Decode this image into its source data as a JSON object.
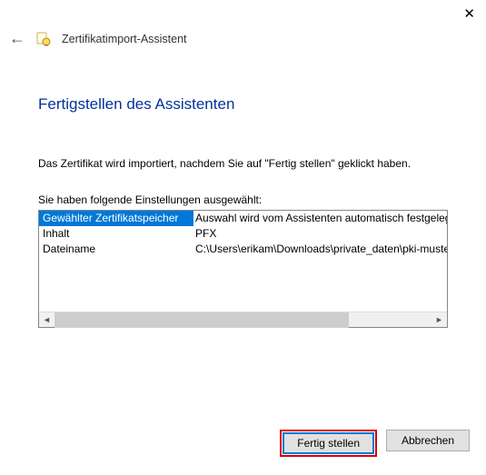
{
  "window": {
    "title": "Zertifikatimport-Assistent"
  },
  "page": {
    "heading": "Fertigstellen des Assistenten",
    "intro": "Das Zertifikat wird importiert, nachdem Sie auf \"Fertig stellen\" geklickt haben.",
    "settings_label": "Sie haben folgende Einstellungen ausgewählt:"
  },
  "settings": {
    "rows": [
      {
        "key": "Gewählter Zertifikatspeicher",
        "value": "Auswahl wird vom Assistenten automatisch festgelegt"
      },
      {
        "key": "Inhalt",
        "value": "PFX"
      },
      {
        "key": "Dateiname",
        "value": "C:\\Users\\erikam\\Downloads\\private_daten\\pki-musterm"
      }
    ]
  },
  "buttons": {
    "finish": "Fertig stellen",
    "cancel": "Abbrechen"
  }
}
